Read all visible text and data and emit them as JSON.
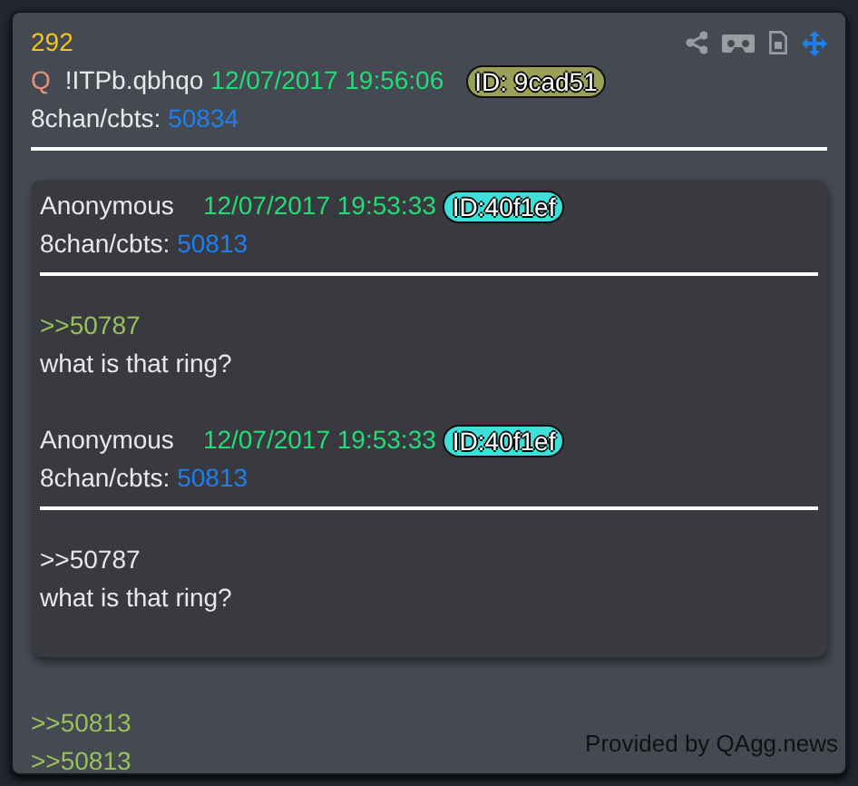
{
  "post": {
    "number": "292",
    "trip_mark": "Q",
    "tripcode": "!ITPb.qbhqo",
    "timestamp": "12/07/2017 19:56:06",
    "id_badge": {
      "text": "ID: 9cad51",
      "color": "#9aa157"
    },
    "board": "8chan/cbts:",
    "post_ref": "50834"
  },
  "quoted_posts": [
    {
      "author": "Anonymous",
      "timestamp": "12/07/2017 19:53:33",
      "id_badge": {
        "text": "ID:40f1ef",
        "color": "#3de0d8"
      },
      "board": "8chan/cbts:",
      "post_ref": "50813",
      "lines": [
        {
          "kind": "reply-link",
          "text": ">>50787"
        },
        {
          "kind": "text",
          "text": "what is that ring?"
        }
      ]
    },
    {
      "author": "Anonymous",
      "timestamp": "12/07/2017 19:53:33",
      "id_badge": {
        "text": "ID:40f1ef",
        "color": "#3de0d8"
      },
      "board": "8chan/cbts:",
      "post_ref": "50813",
      "lines": [
        {
          "kind": "text",
          "text": ">>50787"
        },
        {
          "kind": "text",
          "text": "what is that ring?"
        }
      ]
    }
  ],
  "replies": [
    ">>50813",
    ">>50813"
  ],
  "footer": "Provided by QAgg.news"
}
